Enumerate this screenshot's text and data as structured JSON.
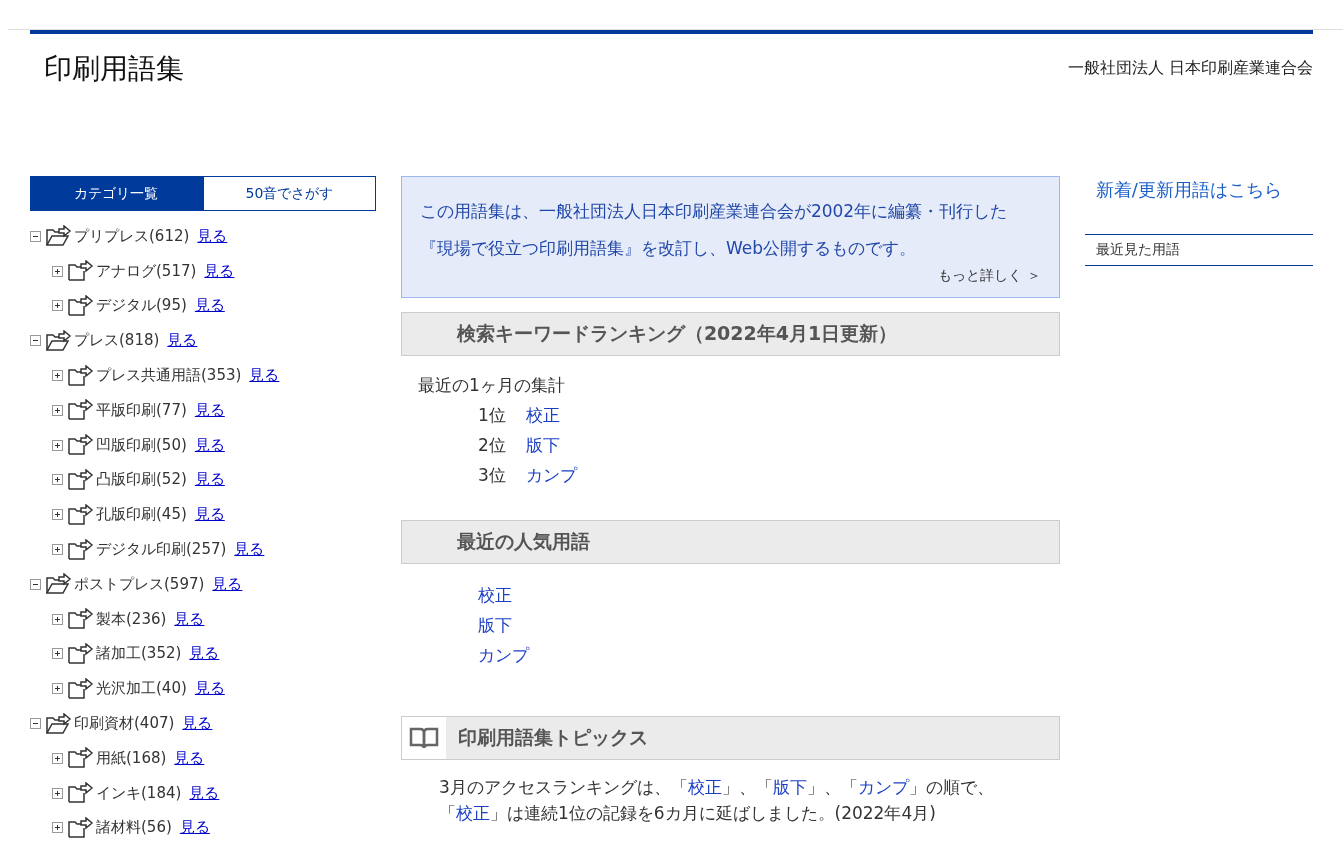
{
  "header": {
    "title": "印刷用語集",
    "organization": "一般社団法人 日本印刷産業連合会"
  },
  "tabs": [
    {
      "label": "カテゴリ一覧",
      "selected": true
    },
    {
      "label": "50音でさがす",
      "selected": false
    }
  ],
  "categories": [
    {
      "label": "プリプレス(612)",
      "link": "見る",
      "expanded": true,
      "children": [
        {
          "label": "アナログ(517)",
          "link": "見る",
          "expanded": false
        },
        {
          "label": "デジタル(95)",
          "link": "見る",
          "expanded": false
        }
      ]
    },
    {
      "label": "プレス(818)",
      "link": "見る",
      "expanded": true,
      "children": [
        {
          "label": "プレス共通用語(353)",
          "link": "見る",
          "expanded": false
        },
        {
          "label": "平版印刷(77)",
          "link": "見る",
          "expanded": false
        },
        {
          "label": "凹版印刷(50)",
          "link": "見る",
          "expanded": false
        },
        {
          "label": "凸版印刷(52)",
          "link": "見る",
          "expanded": false
        },
        {
          "label": "孔版印刷(45)",
          "link": "見る",
          "expanded": false
        },
        {
          "label": "デジタル印刷(257)",
          "link": "見る",
          "expanded": false
        }
      ]
    },
    {
      "label": "ポストプレス(597)",
      "link": "見る",
      "expanded": true,
      "children": [
        {
          "label": "製本(236)",
          "link": "見る",
          "expanded": false
        },
        {
          "label": "諸加工(352)",
          "link": "見る",
          "expanded": false
        },
        {
          "label": "光沢加工(40)",
          "link": "見る",
          "expanded": false
        }
      ]
    },
    {
      "label": "印刷資材(407)",
      "link": "見る",
      "expanded": true,
      "children": [
        {
          "label": "用紙(168)",
          "link": "見る",
          "expanded": false
        },
        {
          "label": "インキ(184)",
          "link": "見る",
          "expanded": false
        },
        {
          "label": "諸材料(56)",
          "link": "見る",
          "expanded": false
        }
      ]
    }
  ],
  "intro": {
    "text": "この用語集は、一般社団法人日本印刷産業連合会が2002年に編纂・刊行した『現場で役立つ印刷用語集』を改訂し、Web公開するものです。",
    "more_link": "もっと詳しく ＞"
  },
  "ranking": {
    "heading": "検索キーワードランキング（2022年4月1日更新）",
    "note": "最近の1ヶ月の集計",
    "items": [
      {
        "rank": "1位",
        "term": "校正"
      },
      {
        "rank": "2位",
        "term": "版下"
      },
      {
        "rank": "3位",
        "term": "カンプ"
      }
    ]
  },
  "popular": {
    "heading": "最近の人気用語",
    "items": [
      "校正",
      "版下",
      "カンプ"
    ]
  },
  "topics": {
    "heading": "印刷用語集トピックス",
    "segments": [
      {
        "text": "3月のアクセスランキングは、「",
        "link": false
      },
      {
        "text": "校正",
        "link": true
      },
      {
        "text": "」、「",
        "link": false
      },
      {
        "text": "版下",
        "link": true
      },
      {
        "text": "」、「",
        "link": false
      },
      {
        "text": "カンプ",
        "link": true
      },
      {
        "text": "」の順で、「",
        "link": false
      },
      {
        "text": "校正",
        "link": true
      },
      {
        "text": "」は連続1位の記録を6カ月に延ばしました。(2022年4月)",
        "link": false
      }
    ]
  },
  "sidebar": {
    "new_terms_link": "新着/更新用語はこちら",
    "recent_heading": "最近見た用語"
  }
}
